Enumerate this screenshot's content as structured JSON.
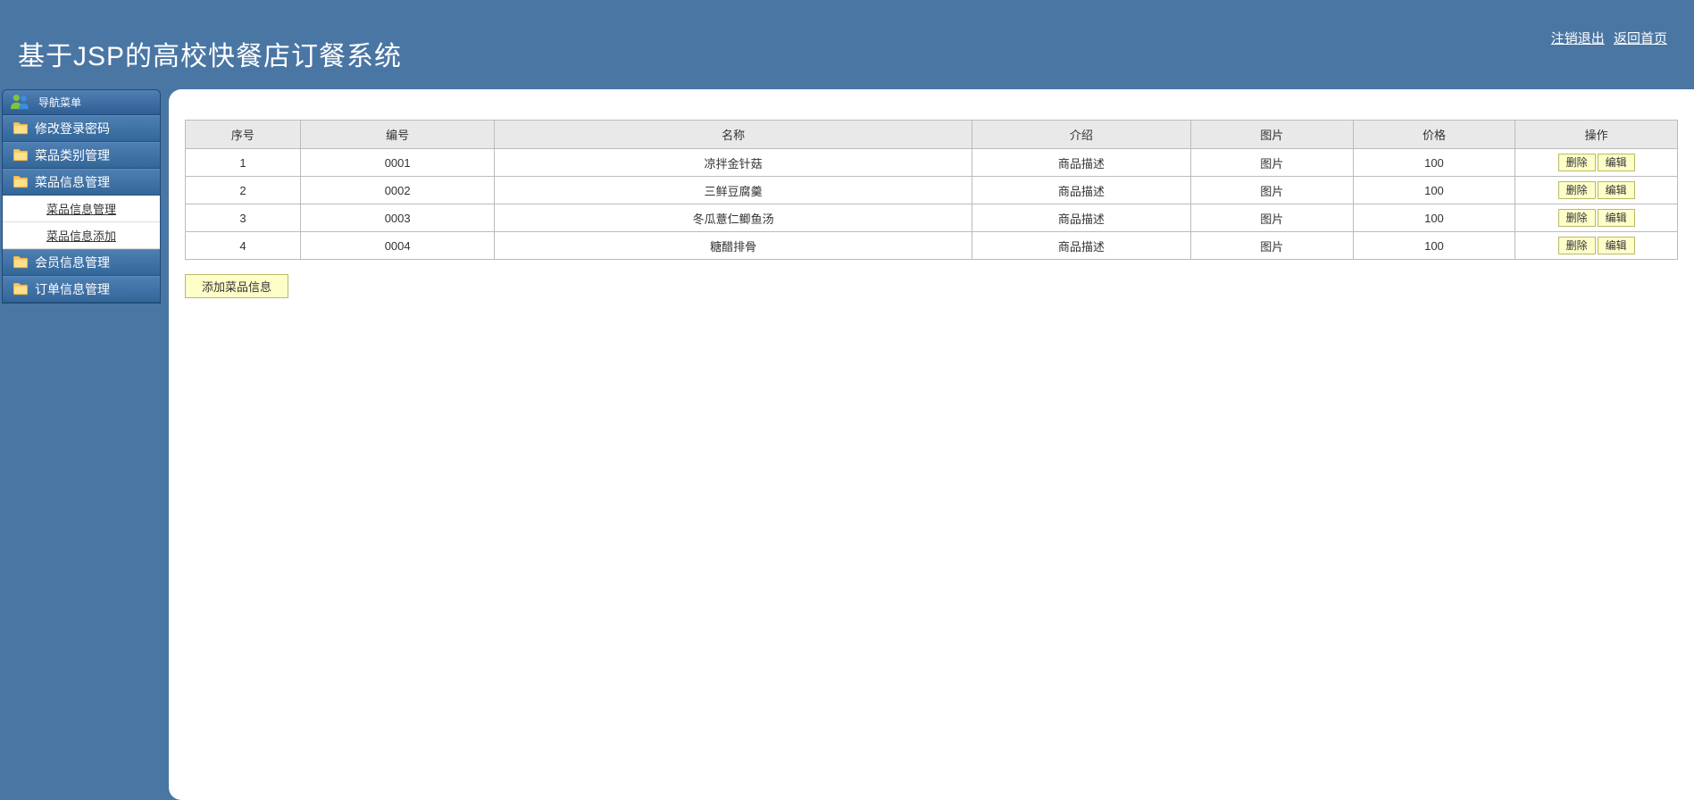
{
  "header": {
    "title": "基于JSP的高校快餐店订餐系统",
    "logout": "注销退出",
    "home": "返回首页"
  },
  "sidebar": {
    "header": "导航菜单",
    "items": [
      {
        "label": "修改登录密码",
        "sub": []
      },
      {
        "label": "菜品类别管理",
        "sub": []
      },
      {
        "label": "菜品信息管理",
        "sub": [
          "菜品信息管理",
          "菜品信息添加"
        ],
        "expanded": true
      },
      {
        "label": "会员信息管理",
        "sub": []
      },
      {
        "label": "订单信息管理",
        "sub": []
      }
    ]
  },
  "table": {
    "headers": [
      "序号",
      "编号",
      "名称",
      "介绍",
      "图片",
      "价格",
      "操作"
    ],
    "rows": [
      {
        "idx": "1",
        "code": "0001",
        "name": "凉拌金针菇",
        "intro": "商品描述",
        "pic": "图片",
        "price": "100"
      },
      {
        "idx": "2",
        "code": "0002",
        "name": "三鲜豆腐羹",
        "intro": "商品描述",
        "pic": "图片",
        "price": "100"
      },
      {
        "idx": "3",
        "code": "0003",
        "name": "冬瓜薏仁鲫鱼汤",
        "intro": "商品描述",
        "pic": "图片",
        "price": "100"
      },
      {
        "idx": "4",
        "code": "0004",
        "name": "糖醋排骨",
        "intro": "商品描述",
        "pic": "图片",
        "price": "100"
      }
    ],
    "actions": {
      "delete": "删除",
      "edit": "编辑"
    },
    "add": "添加菜品信息"
  }
}
